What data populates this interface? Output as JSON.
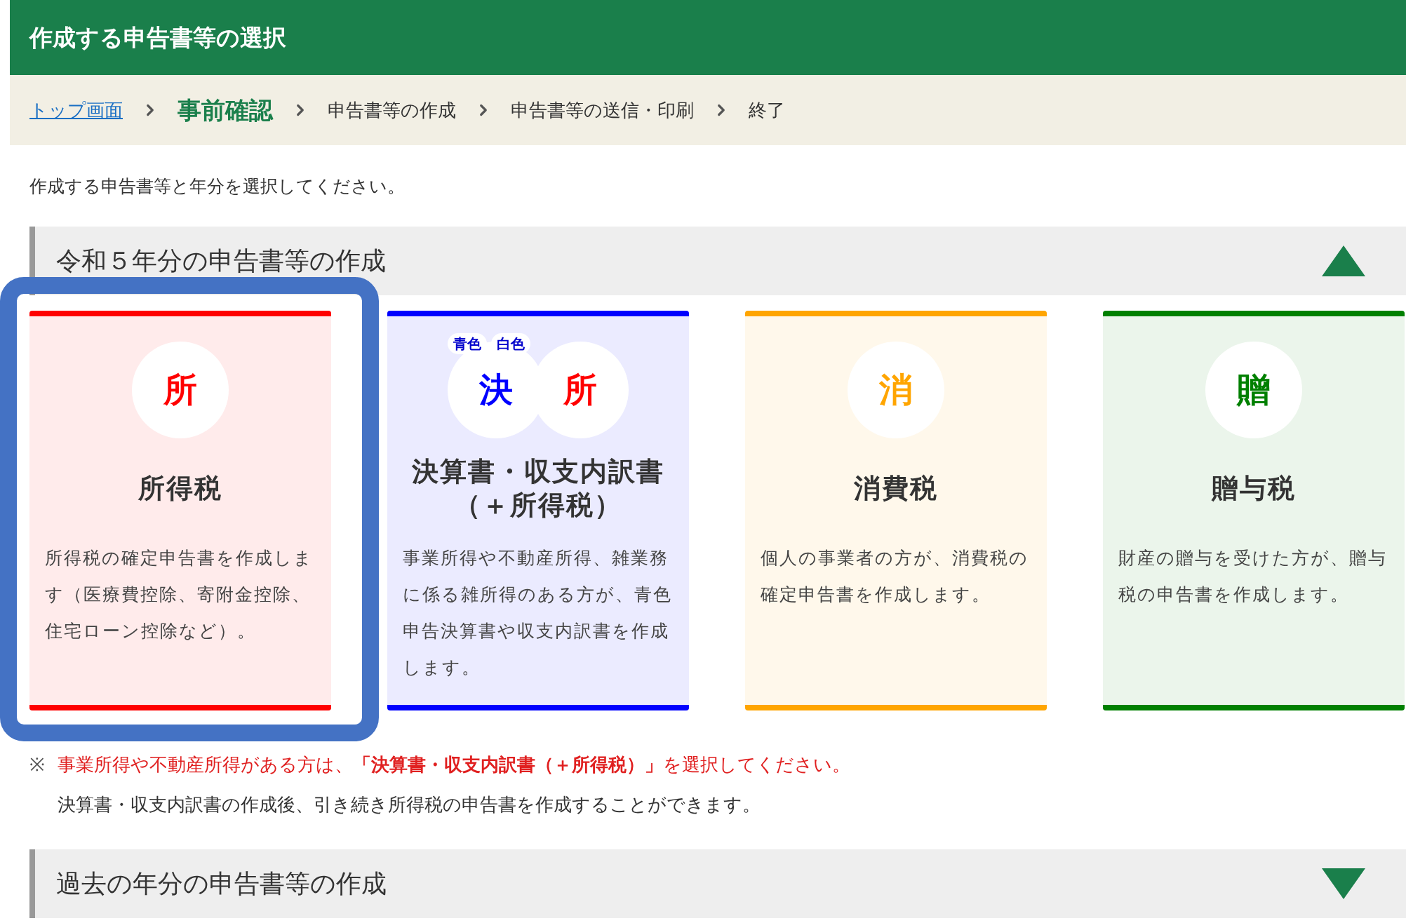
{
  "header": {
    "title": "作成する申告書等の選択"
  },
  "breadcrumb": [
    {
      "label": "トップ画面",
      "kind": "link"
    },
    {
      "label": "事前確認",
      "kind": "current"
    },
    {
      "label": "申告書等の作成",
      "kind": "step"
    },
    {
      "label": "申告書等の送信・印刷",
      "kind": "step"
    },
    {
      "label": "終了",
      "kind": "step"
    }
  ],
  "instruction": "作成する申告書等と年分を選択してください。",
  "current_year_section": {
    "title": "令和５年分の申告書等の作成",
    "expanded": true,
    "cards": [
      {
        "title": [
          "所得税"
        ],
        "description": "所得税の確定申告書を作成します（医療費控除、寄附金控除、住宅ローン控除など）。",
        "color": "#ff0000",
        "highlighted": true,
        "icons": [
          {
            "char": "所",
            "color": "#ff0000"
          }
        ]
      },
      {
        "title": [
          "決算書・収支内訳書",
          "（＋所得税）"
        ],
        "description": "事業所得や不動産所得、雑業務に係る雑所得のある方が、青色申告決算書や収支内訳書を作成します。",
        "color": "#0000ff",
        "highlighted": false,
        "icons": [
          {
            "char": "決",
            "color": "#0000ff",
            "tag": "青色"
          },
          {
            "char": "所",
            "color": "#ff0000",
            "tag": "白色"
          }
        ]
      },
      {
        "title": [
          "消費税"
        ],
        "description": "個人の事業者の方が、消費税の確定申告書を作成します。",
        "color": "#ffa500",
        "highlighted": false,
        "icons": [
          {
            "char": "消",
            "color": "#ffa500"
          }
        ]
      },
      {
        "title": [
          "贈与税"
        ],
        "description": "財産の贈与を受けた方が、贈与税の申告書を作成します。",
        "color": "#008000",
        "highlighted": false,
        "icons": [
          {
            "char": "贈",
            "color": "#008000"
          }
        ]
      }
    ]
  },
  "note": {
    "mark": "※",
    "lines": [
      "事業所得や不動産所得がある方は、**「決算書・収支内訳書（＋所得税）」**を選択してください。",
      "決算書・収支内訳書の作成後、引き続き所得税の申告書を作成することができます。"
    ]
  },
  "past_years_section": {
    "title": "過去の年分の申告書等の作成",
    "expanded": false
  }
}
